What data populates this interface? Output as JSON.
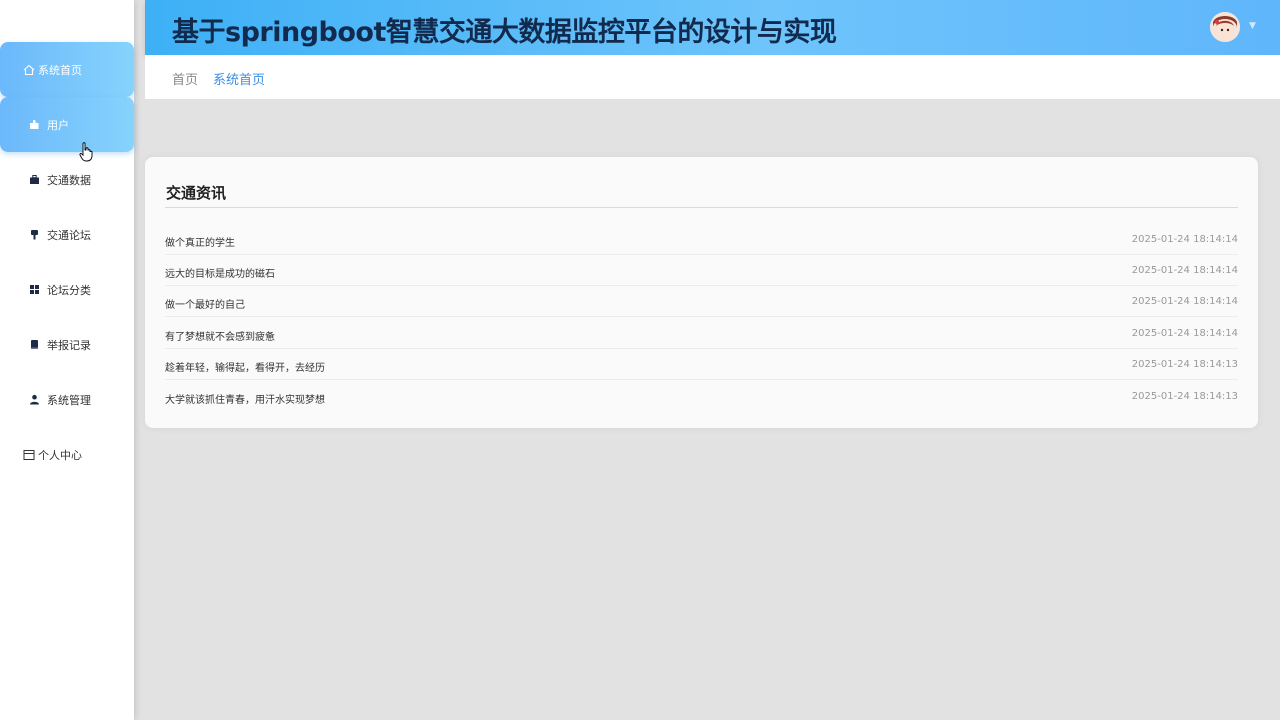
{
  "header": {
    "title": "基于springboot智慧交通大数据监控平台的设计与实现"
  },
  "sidebar": {
    "items": [
      {
        "label": "系统首页",
        "icon": "home-icon"
      },
      {
        "label": "用户",
        "icon": "puzzle-icon"
      },
      {
        "label": "交通数据",
        "icon": "briefcase-icon"
      },
      {
        "label": "交通论坛",
        "icon": "brush-icon"
      },
      {
        "label": "论坛分类",
        "icon": "grid-icon"
      },
      {
        "label": "举报记录",
        "icon": "book-icon"
      },
      {
        "label": "系统管理",
        "icon": "user-icon"
      },
      {
        "label": "个人中心",
        "icon": "window-icon"
      }
    ]
  },
  "breadcrumb": {
    "home": "首页",
    "current": "系统首页"
  },
  "news": {
    "title": "交通资讯",
    "items": [
      {
        "title": "做个真正的学生",
        "date": "2025-01-24 18:14:14"
      },
      {
        "title": "远大的目标是成功的磁石",
        "date": "2025-01-24 18:14:14"
      },
      {
        "title": "做一个最好的自己",
        "date": "2025-01-24 18:14:14"
      },
      {
        "title": "有了梦想就不会感到疲惫",
        "date": "2025-01-24 18:14:14"
      },
      {
        "title": "趁着年轻，输得起，看得开，去经历",
        "date": "2025-01-24 18:14:13"
      },
      {
        "title": "大学就该抓住青春，用汗水实现梦想",
        "date": "2025-01-24 18:14:13"
      }
    ]
  },
  "colors": {
    "accent": "#3a8ee6",
    "header_gradient_start": "#3db0f6",
    "header_gradient_end": "#5fb6fb",
    "active_menu": "#6bb8fb",
    "background": "#e2e2e2"
  }
}
